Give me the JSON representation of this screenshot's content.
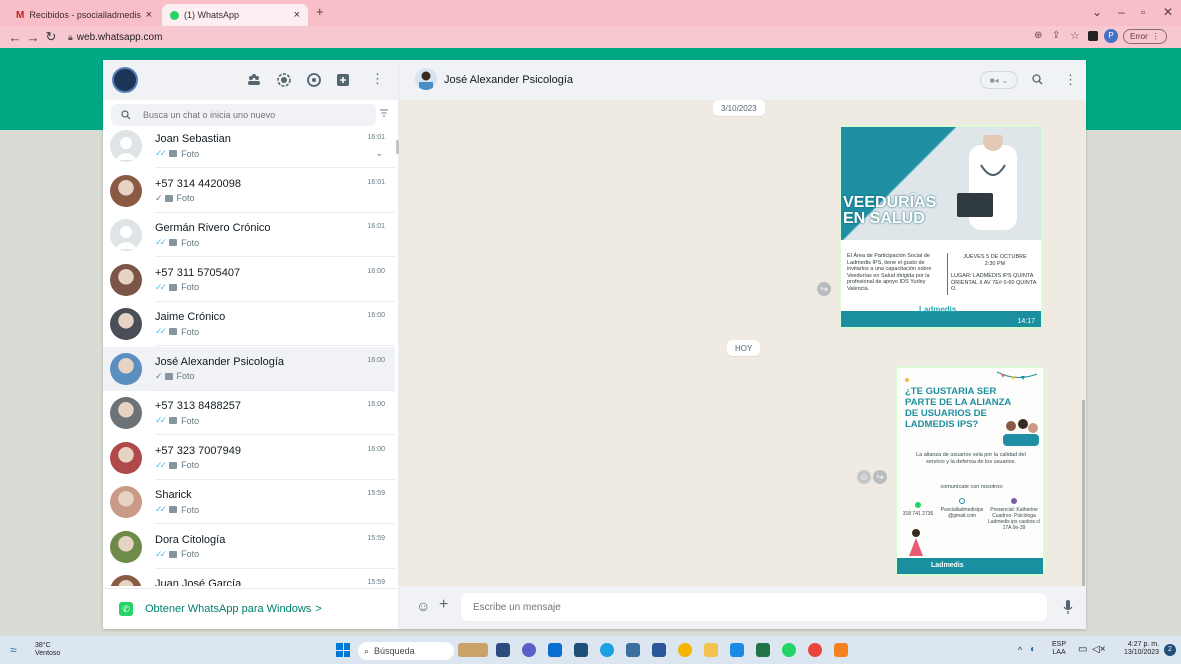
{
  "browser": {
    "tabs": [
      {
        "title": "Recibidos - psocialladmedisips@",
        "icon_color": "#c5221f"
      },
      {
        "title": "(1) WhatsApp",
        "icon_color": "#25d366"
      }
    ],
    "new_tab": "+",
    "url": "web.whatsapp.com",
    "error_label": "Error",
    "profile_initial": "P"
  },
  "sidebar": {
    "search_placeholder": "Busca un chat o inicia uno nuevo",
    "chats": [
      {
        "name": "Joan Sebastian",
        "preview": "Foto",
        "time": "16:01",
        "tick": "blue",
        "avatar": "default"
      },
      {
        "name": "+57 314 4420098",
        "preview": "Foto",
        "time": "16:01",
        "tick": "gray-single",
        "avatar": "photo",
        "color": "#8a5a44"
      },
      {
        "name": "Germán Rivero Crónico",
        "preview": "Foto",
        "time": "16:01",
        "tick": "blue",
        "avatar": "default"
      },
      {
        "name": "+57 311 5705407",
        "preview": "Foto",
        "time": "16:00",
        "tick": "blue",
        "avatar": "photo",
        "color": "#7a5548"
      },
      {
        "name": "Jaime Crónico",
        "preview": "Foto",
        "time": "16:00",
        "tick": "blue",
        "avatar": "photo",
        "color": "#4a4f57"
      },
      {
        "name": "José Alexander Psicología",
        "preview": "Foto",
        "time": "16:00",
        "tick": "gray-single",
        "avatar": "photo",
        "color": "#5b8fc0"
      },
      {
        "name": "+57 313 8488257",
        "preview": "Foto",
        "time": "16:00",
        "tick": "blue",
        "avatar": "photo",
        "color": "#6b7278"
      },
      {
        "name": "+57 323 7007949",
        "preview": "Foto",
        "time": "16:00",
        "tick": "blue",
        "avatar": "photo",
        "color": "#b04a4a"
      },
      {
        "name": "Sharick",
        "preview": "Foto",
        "time": "15:59",
        "tick": "blue",
        "avatar": "photo",
        "color": "#c99a86"
      },
      {
        "name": "Dora Citología",
        "preview": "Foto",
        "time": "15:59",
        "tick": "blue",
        "avatar": "photo",
        "color": "#6f8b4a"
      },
      {
        "name": "Juan José García",
        "preview": "",
        "time": "15:59",
        "tick": "",
        "avatar": "photo",
        "color": "#8a5a44"
      }
    ],
    "get_app": "Obtener WhatsApp para Windows",
    "get_app_arrow": ">"
  },
  "conversation": {
    "contact_name": "José Alexander Psicología",
    "date_chip_1": "3/10/2023",
    "date_chip_2": "HOY",
    "message_1": {
      "title_line1": "VEEDURÍAS",
      "title_line2": "EN SALUD",
      "description": "El Área de Participación Social de Ladmedis IPS, tiene el gusto de invitarlos a una capacitación sobre Veedurías en Salud dirigida por la profesional de apoyo IDS Yurley Valencia.",
      "date": "JUEVES 5 DE OCTUBRE",
      "hour": "2:30 PM",
      "place": "LUGAR: LADMEDIS IPS QUINTA ORIENTAL II AV 7E# 0-60 QUINTA O.",
      "logo": "Ladmedis",
      "time": "14:17"
    },
    "message_2": {
      "headline": "¿TE GUSTARIA SER PARTE DE LA ALIANZA DE USUARIOS DE LADMEDIS IPS?",
      "body": "La alianza de usuarios vela por la calidad del servicio y la defensa de los usuarios.",
      "contact_label": "comunícate con nosotros:",
      "phone": "318 741 2736",
      "email": "Psocialladmedisips @gmail.com",
      "presencial": "Presencial: Katherine Cuadros- Psicóloga Ladmedis ips caobos cl 17A 0e-39",
      "logo": "Ladmedis"
    },
    "composer_placeholder": "Escribe un mensaje"
  },
  "taskbar": {
    "weather_temp": "38°C",
    "weather_desc": "Ventoso",
    "search_label": "Búsqueda",
    "lang_line1": "ESP",
    "lang_line2": "LAA",
    "clock_time": "4:27 p. m.",
    "clock_date": "13/10/2023",
    "notification_count": "2"
  },
  "colors": {
    "whatsapp_green": "#00a884",
    "bubble_green": "#d9fdd3",
    "tab_pink": "#f8bfc9",
    "teal": "#1f8fa3"
  }
}
